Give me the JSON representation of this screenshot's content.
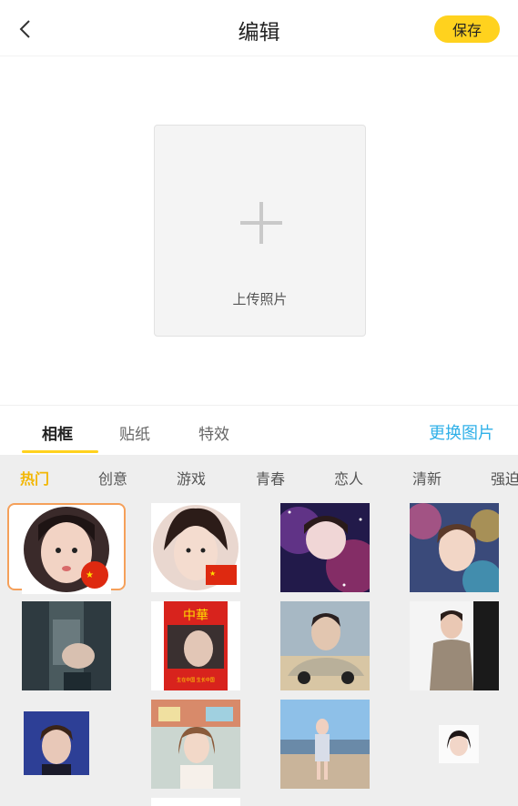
{
  "header": {
    "title": "编辑",
    "save_label": "保存"
  },
  "upload": {
    "label": "上传照片"
  },
  "tabs": {
    "items": [
      {
        "label": "相框",
        "active": true
      },
      {
        "label": "贴纸",
        "active": false
      },
      {
        "label": "特效",
        "active": false
      }
    ],
    "change_image_label": "更换图片"
  },
  "categories": {
    "items": [
      {
        "label": "热门",
        "active": true
      },
      {
        "label": "创意",
        "active": false
      },
      {
        "label": "游戏",
        "active": false
      },
      {
        "label": "青春",
        "active": false
      },
      {
        "label": "恋人",
        "active": false
      },
      {
        "label": "清新",
        "active": false
      },
      {
        "label": "强迫",
        "active": false
      }
    ]
  },
  "flag_text": "★",
  "colors": {
    "accent_yellow": "#ffd21e",
    "category_active": "#f2b705",
    "link_blue": "#2fb0e8",
    "selection_border": "#f5a05a"
  },
  "frames": {
    "poster_top": "中華",
    "poster_bottom": "生在中国 生长中国"
  }
}
